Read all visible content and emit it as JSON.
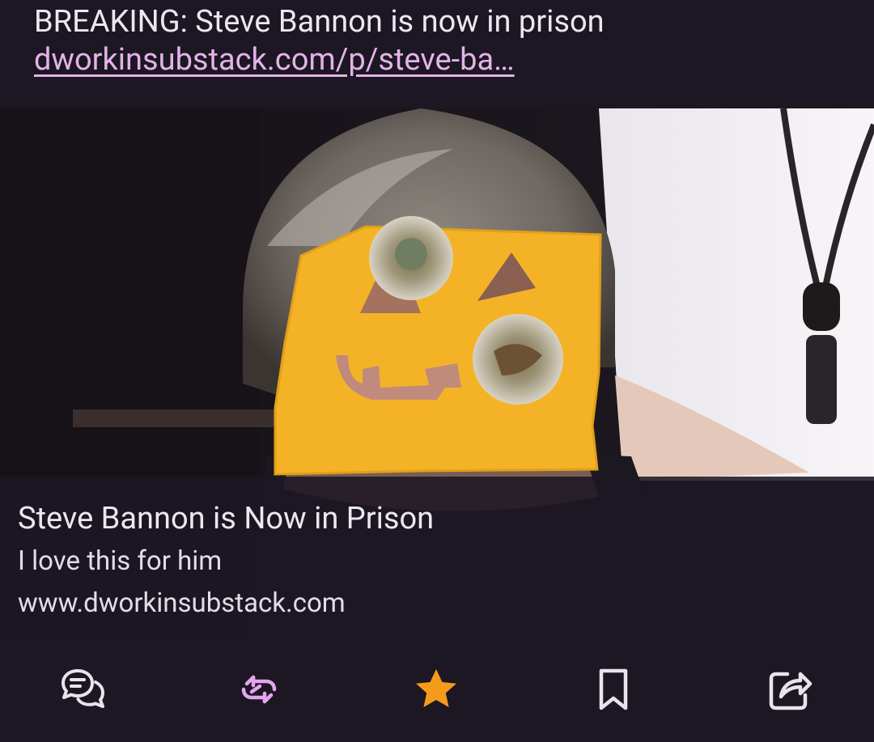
{
  "post": {
    "body_text": "BREAKING: Steve Bannon is now in prison",
    "link_text": "dworkinsubstack.com/p/steve-ba…"
  },
  "preview_card": {
    "title": "Steve Bannon is Now in Prison",
    "description": "I love this for him",
    "domain": "www.dworkinsubstack.com"
  },
  "actions": [
    {
      "icon": "reply-icon",
      "color": "#e8e4ec"
    },
    {
      "icon": "boost-icon",
      "color": "#e3a6f0",
      "active": true
    },
    {
      "icon": "favourite-icon",
      "color": "#f59b1b",
      "active": true
    },
    {
      "icon": "bookmark-icon",
      "color": "#e8e4ec"
    },
    {
      "icon": "share-icon",
      "color": "#e8e4ec"
    }
  ],
  "colors": {
    "background": "#1c1723",
    "link": "#e3b3e8",
    "boost_active": "#e3a6f0",
    "favourite_active": "#f59b1b"
  }
}
